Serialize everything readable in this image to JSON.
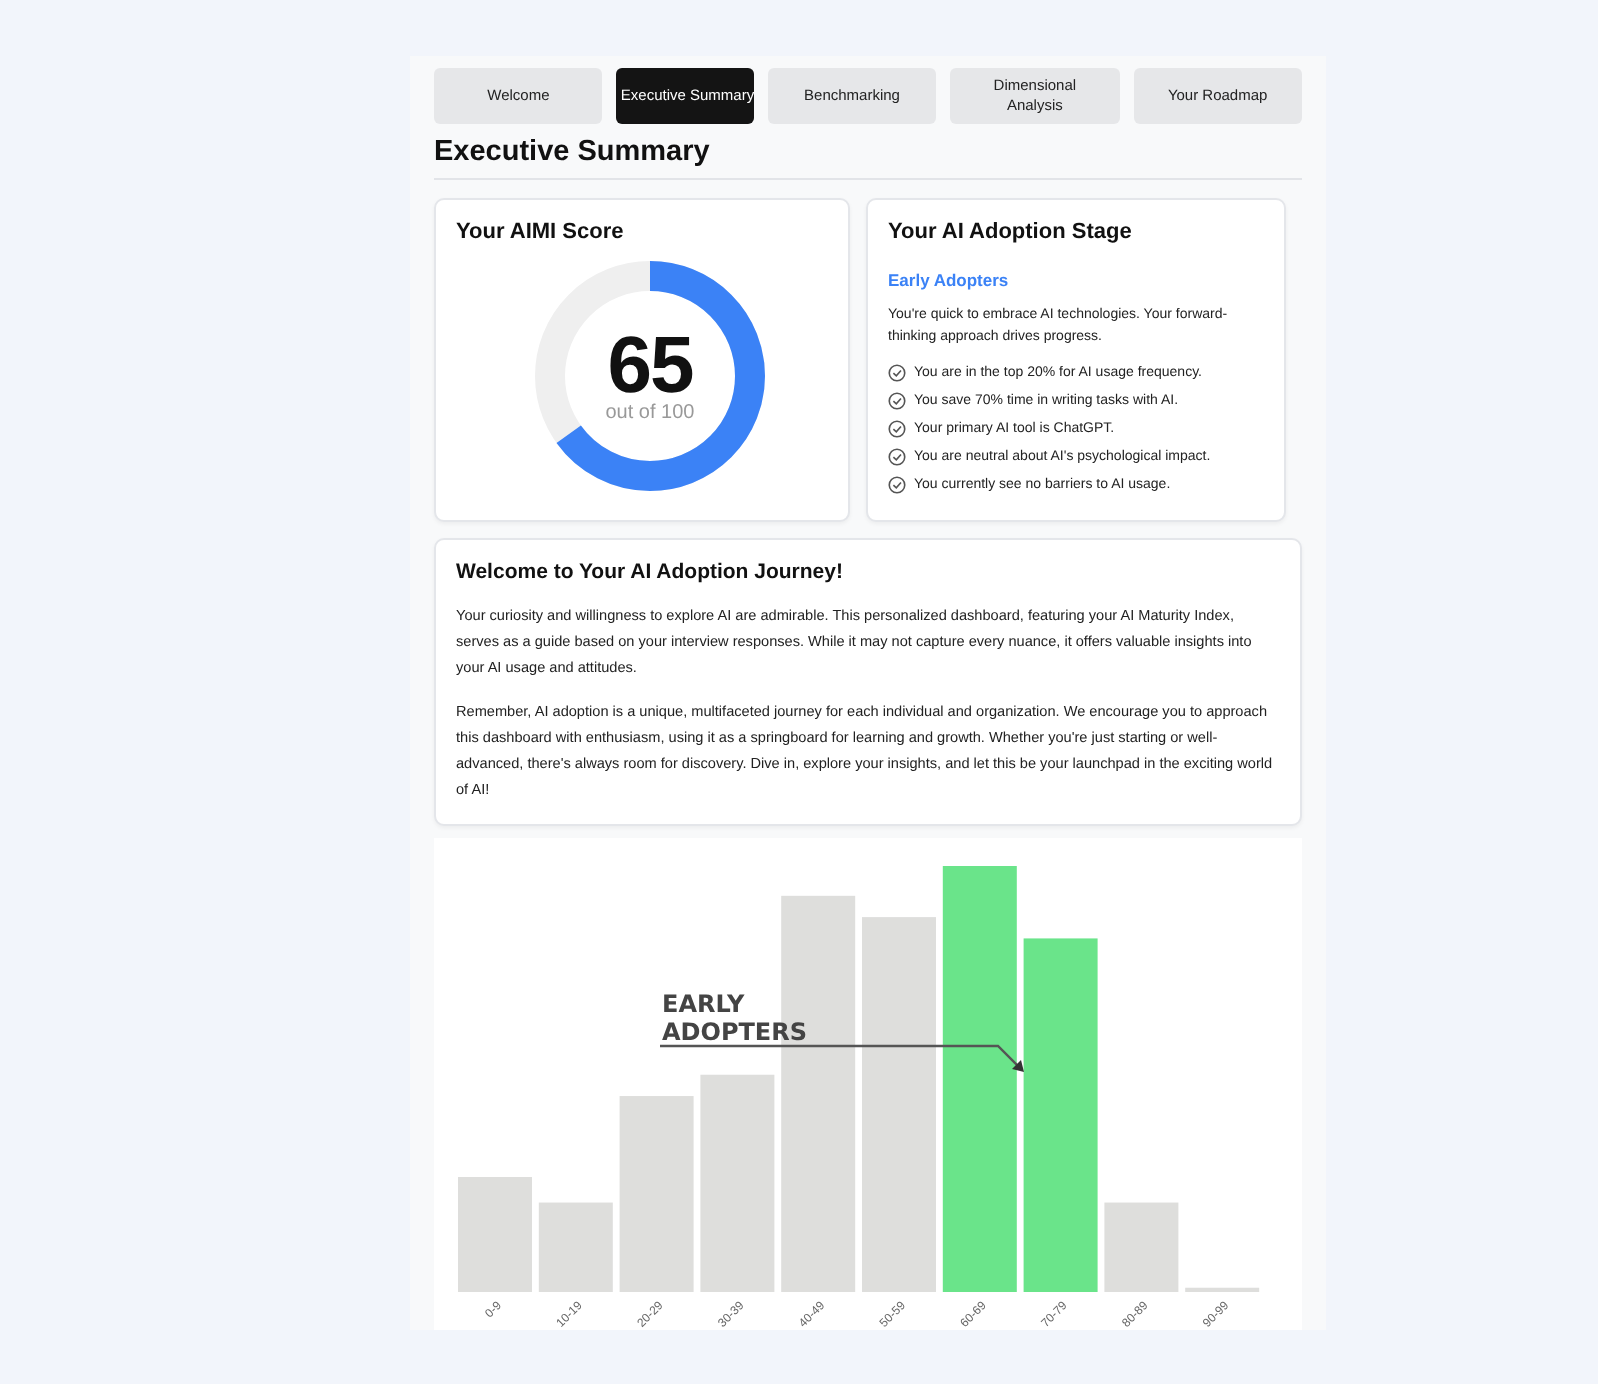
{
  "tabs": [
    {
      "label": "Welcome",
      "selected": false
    },
    {
      "label": "Executive Summary",
      "selected": true
    },
    {
      "label": "Benchmarking",
      "selected": false
    },
    {
      "label": "Dimensional Analysis",
      "selected": false
    },
    {
      "label": "Your Roadmap",
      "selected": false
    }
  ],
  "heading": "Executive Summary",
  "score_card": {
    "title": "Your AIMI Score",
    "score": "65",
    "caption": "out of 100",
    "level": 0.65
  },
  "stage_card": {
    "title": "Your AI Adoption Stage",
    "stage": "Early Adopters",
    "description": "You're quick to embrace AI technologies. Your forward-thinking approach drives progress.",
    "points": [
      "You are in the top 20% for AI usage frequency.",
      "You save 70% time in writing tasks with AI.",
      "Your primary AI tool is ChatGPT.",
      "You are neutral about AI's psychological impact.",
      "You currently see no barriers to AI usage."
    ]
  },
  "welcome_card": {
    "title": "Welcome to Your AI Adoption Journey!",
    "paragraphs": [
      "Your curiosity and willingness to explore AI are admirable. This personalized dashboard, featuring your AI Maturity Index, serves as a guide based on your interview responses. While it may not capture every nuance, it offers valuable insights into your AI usage and attitudes.",
      "Remember, AI adoption is a unique, multifaceted journey for each individual and organization. We encourage you to approach this dashboard with enthusiasm, using it as a springboard for learning and growth. Whether you're just starting or well-advanced, there's always room for discovery. Dive in, explore your insights, and let this be your launchpad in the exciting world of AI!"
    ]
  },
  "distribution": {
    "annotation": [
      "EARLY",
      "ADOPTERS"
    ],
    "bins": [
      {
        "label": "0-9",
        "selected": false
      },
      {
        "label": "10-19",
        "selected": false
      },
      {
        "label": "20-29",
        "selected": false
      },
      {
        "label": "30-39",
        "selected": false
      },
      {
        "label": "40-49",
        "selected": false
      },
      {
        "label": "50-59",
        "selected": false
      },
      {
        "label": "60-69",
        "selected": true
      },
      {
        "label": "70-79",
        "selected": true
      },
      {
        "label": "80-89",
        "selected": false
      },
      {
        "label": "90-99",
        "selected": false
      }
    ]
  }
}
